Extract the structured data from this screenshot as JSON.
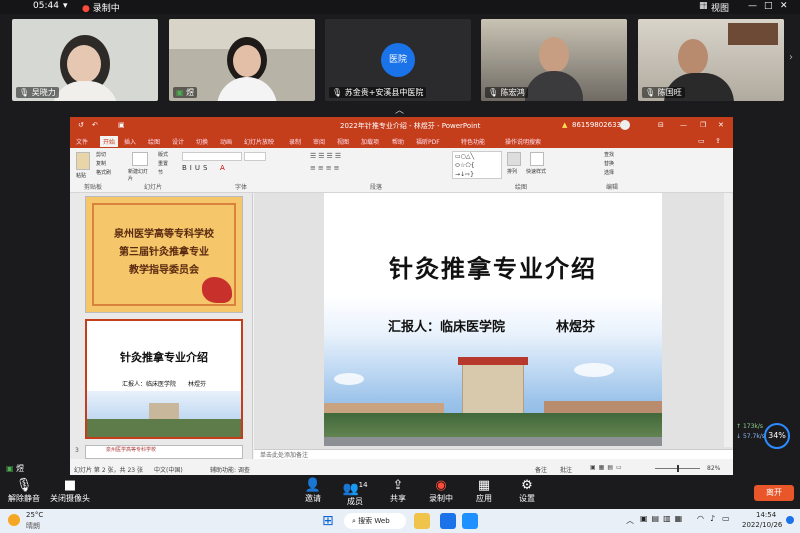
{
  "status_bar": {
    "time": "05:44",
    "recording": "录制中",
    "view_label": "视图"
  },
  "participants": [
    {
      "name": "吴晓力",
      "color": "#cfd4cf"
    },
    {
      "name": "煜",
      "color": "#b8b3a7"
    },
    {
      "name": "苏金贵+安溪县中医院",
      "avatar_text": "医院",
      "color": "#2b2b2d"
    },
    {
      "name": "陈宏鸿",
      "color": "#8d8a84"
    },
    {
      "name": "陈国旺",
      "color": "#a7a39b"
    }
  ],
  "ppt": {
    "window_title": "2022年针推专业介绍 - 林煜芬 - PowerPoint",
    "account": "8615980263316",
    "tabs": [
      "文件",
      "开始",
      "插入",
      "绘图",
      "设计",
      "切换",
      "动画",
      "幻灯片放映",
      "录制",
      "审阅",
      "视图",
      "加载项",
      "帮助",
      "福昕PDF",
      "特色功能"
    ],
    "search_hint": "操作说明搜索",
    "ribbon_groups": [
      "剪贴板",
      "幻灯片",
      "字体",
      "段落",
      "绘图",
      "编辑"
    ],
    "ribbon_buttons": {
      "paste": "粘贴",
      "cut": "剪切",
      "copy": "复制",
      "format_painter": "格式刷",
      "new_slide": "新建幻灯片",
      "layout": "版式",
      "reset": "重置",
      "section": "节",
      "arrange": "排列",
      "quick_styles": "快速样式",
      "find": "查找",
      "replace": "替换",
      "select": "选择"
    },
    "thumb1_lines": [
      "泉州医学高等专科学校",
      "第三届针灸推拿专业",
      "教学指导委员会"
    ],
    "thumb2_title": "针灸推拿专业介绍",
    "thumb2_subtitle": "汇报人：临床医学院　　林煜芬",
    "thumb3_text": "泉州医学高等专科学校",
    "slide_title": "针灸推拿专业介绍",
    "slide_reporter": "汇报人：临床医学院",
    "slide_name": "林煜芬",
    "notes_placeholder": "单击此处添加备注",
    "status_slide": "幻灯片 第 2 张，共 23 张",
    "status_lang": "中文(中国)",
    "status_access": "辅助功能: 调查",
    "status_notes": "备注",
    "status_comments": "批注",
    "zoom": "82%"
  },
  "net": {
    "up": "173k/s",
    "down": "57.7k/s",
    "cpu": "34%"
  },
  "self_view": {
    "name": "煜"
  },
  "controls": [
    "解除静音",
    "关闭摄像头",
    "邀请",
    "成员",
    "共享",
    "录制中",
    "应用",
    "设置"
  ],
  "member_count": "14",
  "leave_label": "离开",
  "taskbar": {
    "weather_temp": "25°C",
    "weather_desc": "晴朗",
    "search": "搜索 Web",
    "time": "14:54",
    "date": "2022/10/26"
  },
  "colors": {
    "ppt_red": "#c43e1c",
    "leave_orange": "#e8562a",
    "record_red": "#ff4b3a"
  }
}
